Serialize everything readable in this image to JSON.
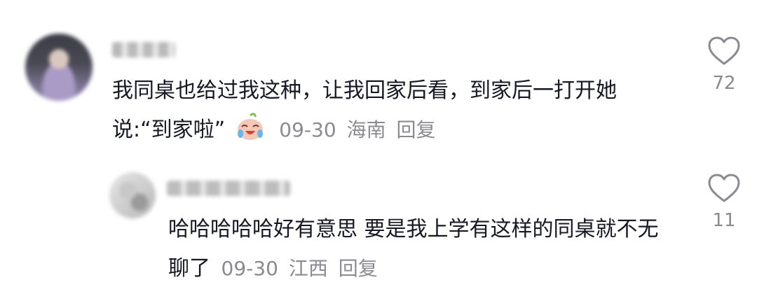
{
  "comments": [
    {
      "text": "我同桌也给过我这种，让我回家后看，到家后一打开她说:“到家啦”",
      "emoji": "crying-laughing-emoji",
      "date": "09-30",
      "location": "海南",
      "reply_label": "回复",
      "likes": "72"
    }
  ],
  "replies": [
    {
      "text": "哈哈哈哈哈好有意思 要是我上学有这样的同桌就不无聊了",
      "date": "09-30",
      "location": "江西",
      "reply_label": "回复",
      "likes": "11"
    }
  ],
  "icons": {
    "like": "heart-outline-icon"
  },
  "colors": {
    "text": "#161823",
    "meta": "#8a8b91"
  }
}
